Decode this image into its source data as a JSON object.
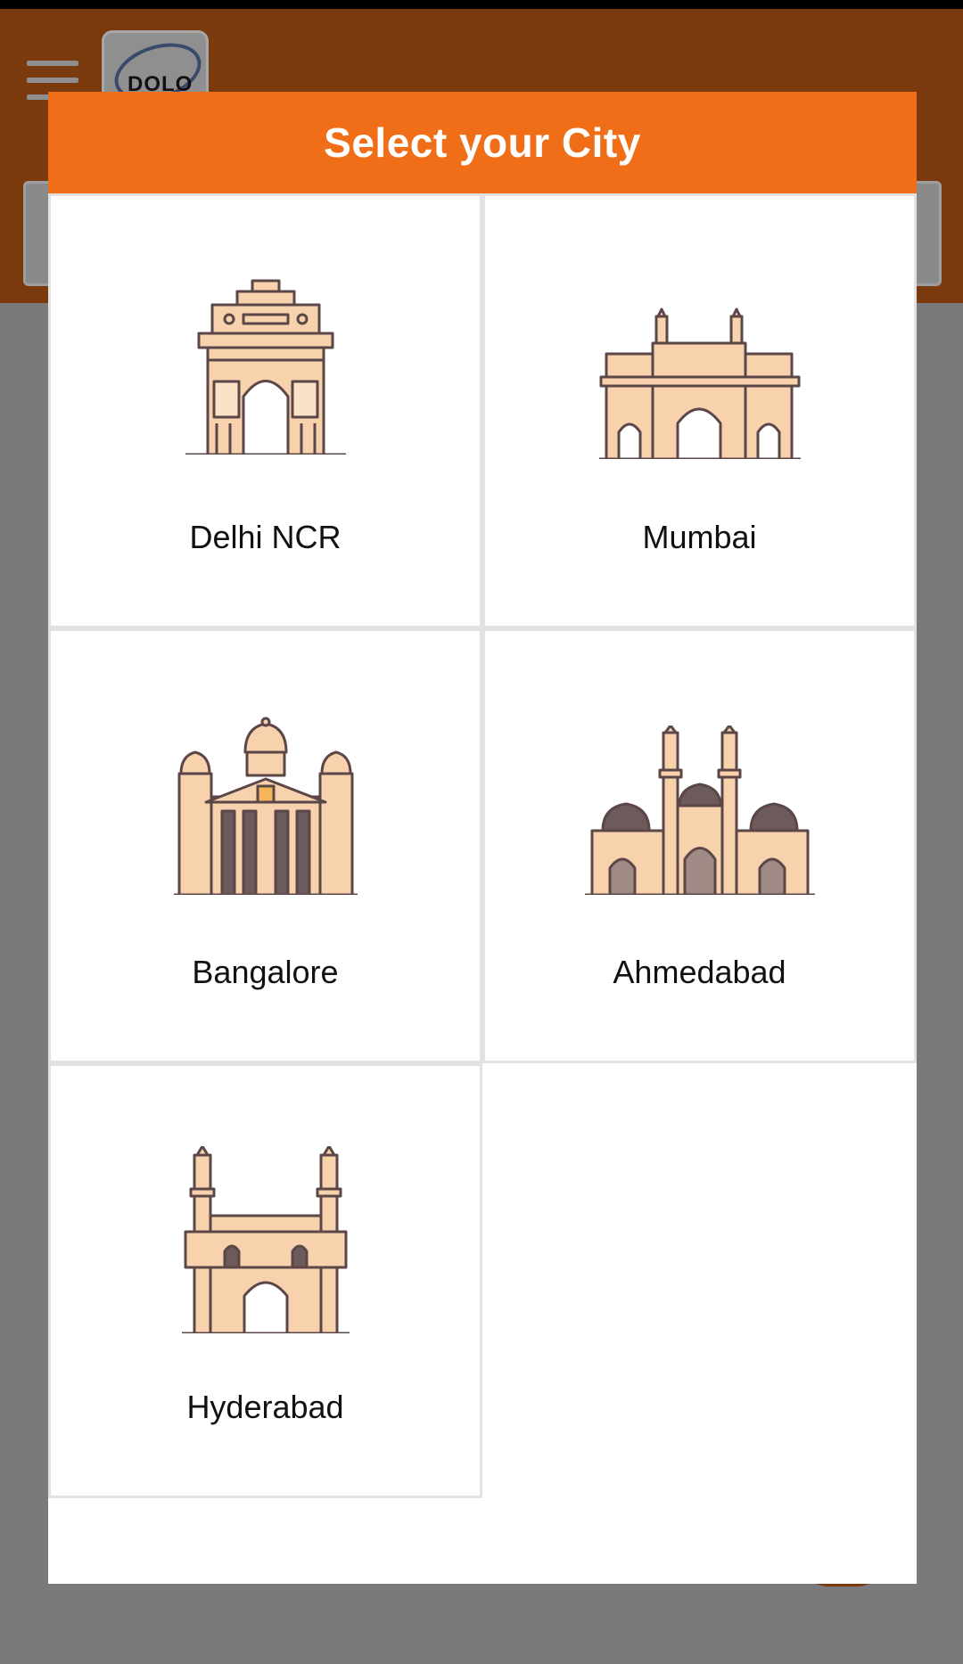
{
  "app": {
    "logo_text": "DOLO"
  },
  "modal": {
    "title": "Select your City"
  },
  "cities": [
    {
      "name": "Delhi NCR"
    },
    {
      "name": "Mumbai"
    },
    {
      "name": "Bangalore"
    },
    {
      "name": "Ahmedabad"
    },
    {
      "name": "Hyderabad"
    }
  ],
  "colors": {
    "header_bg": "#7b3a0e",
    "modal_header": "#f06e17",
    "overlay": "#7a7a7c",
    "monument_fill": "#f7d2ad",
    "monument_stroke": "#5b4748"
  },
  "icons": [
    "menu-icon",
    "india-gate-icon",
    "gateway-of-india-icon",
    "vidhana-soudha-icon",
    "jama-masjid-icon",
    "charminar-icon"
  ]
}
